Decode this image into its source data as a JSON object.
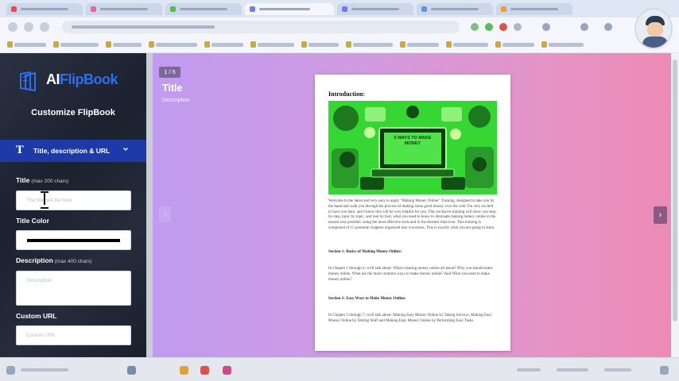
{
  "sidebar": {
    "logo_prefix": "AI",
    "logo_brand": "FlipBook",
    "heading": "Customize FlipBook",
    "section_icon": "T",
    "section_label": "Title, description & URL",
    "title_label": "Title",
    "title_hint": "(max 200 chars)",
    "title_placeholder": "The title will be here",
    "title_color_label": "Title Color",
    "title_color_value": "#000000",
    "description_label": "Description",
    "description_hint": "(max 400 chars)",
    "description_placeholder": "Description",
    "custom_url_label": "Custom URL",
    "custom_url_placeholder": "Custom URL"
  },
  "preview": {
    "pager": "1 / 5",
    "title": "Title",
    "description": "Description",
    "nav_prev": "‹",
    "nav_next": "›"
  },
  "book_page": {
    "heading": "Introduction:",
    "image_caption": "5 WAYS TO MAKE MONEY",
    "intro": "Welcome to the latest and very easy to apply \"Making Money Online\" Training, designed to take you by the hand and walk you through the process of making some good money over the web. I'm very excited to have you here, and I know this will be very helpful for you. This exclusive training will show you step-by-step, topic by topic, and tool by tool, what you need to know to dominate making money online in the easiest way possible, using the most effective tools and in the shortest time ever. This training is comprised of 11 premium chapters organized into 4 sections. This is exactly what you are going to learn.",
    "section1_title": "Section 1: Basics of Making Money Online:",
    "section1_text": "In Chapter 1 through 4, we'll talk about: What's making money online all about? Why you should make money online, What are the most common ways to make money online? And What you need to make money online?",
    "section2_title": "Section 2: Easy Ways to Make Money Online:",
    "section2_text": "In Chapter 5 through 7, we'll talk about: Making Easy Money Online by Taking Surveys, Making Easy Money Online by Testing Stuff and Making Easy Money Online by Performing Easy Tasks"
  },
  "colors": {
    "sidebar_bg": "#1f2533",
    "section_bar": "#1e3aa8",
    "brand_blue": "#2f6df0",
    "preview_gradient_start": "#c09bf0",
    "preview_gradient_end": "#ee8ab6",
    "image_green": "#3ee23a"
  },
  "icons": {
    "section_chevron": "chevron-down-icon",
    "text_type": "text-format-icon",
    "cursor": "text-cursor-icon"
  }
}
